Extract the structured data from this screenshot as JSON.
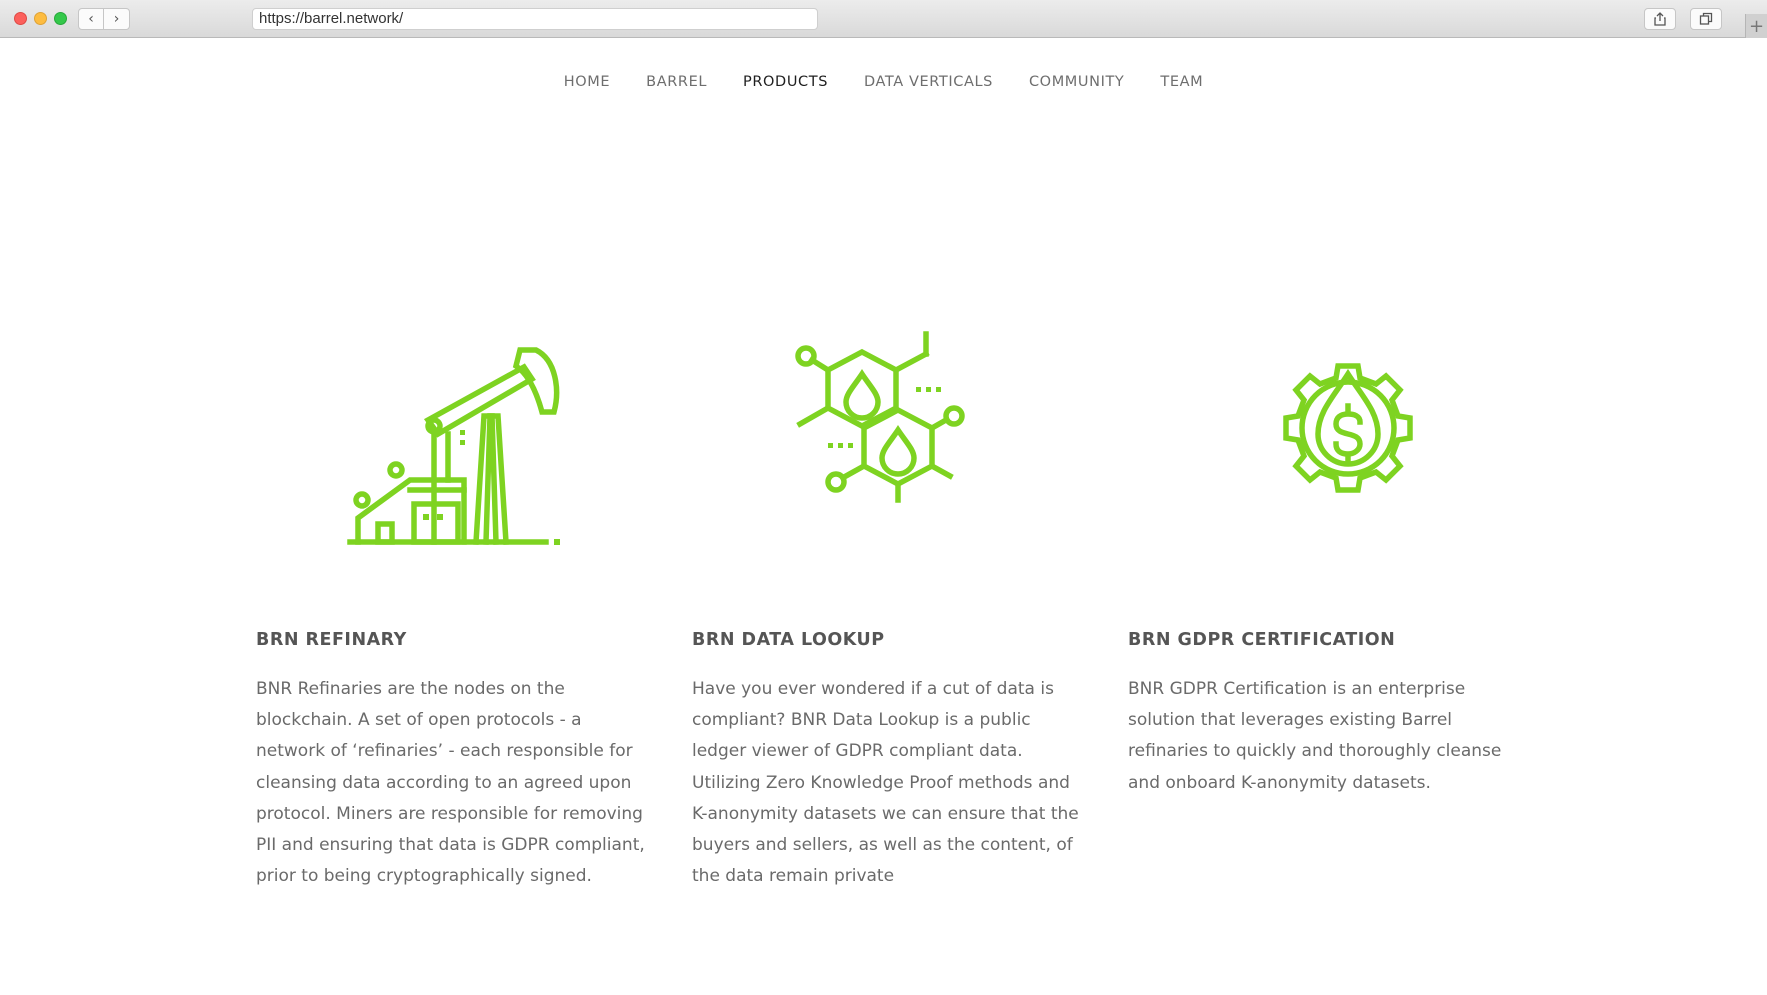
{
  "browser": {
    "url": "https://barrel.network/",
    "back_glyph": "‹",
    "forward_glyph": "›",
    "new_tab_glyph": "+"
  },
  "nav": {
    "items": [
      {
        "label": "HOME"
      },
      {
        "label": "BARREL"
      },
      {
        "label": "PRODUCTS",
        "active": true
      },
      {
        "label": "DATA VERTICALS"
      },
      {
        "label": "COMMUNITY"
      },
      {
        "label": "TEAM"
      }
    ]
  },
  "colors": {
    "accent": "#7ed321",
    "heading": "#555555",
    "body_text": "#6a6a6a",
    "nav_text": "#6e6e6e",
    "nav_active": "#1f1f1f"
  },
  "products": [
    {
      "icon": "oil-pump-refinery-icon",
      "title": "BRN REFINARY",
      "description": "BNR Refinaries are the nodes on the blockchain.  A set of open protocols - a network of ‘refinaries’ - each responsible for cleansing data according to an agreed upon protocol. Miners are responsible for removing PII and ensuring that data is GDPR compliant, prior to being cryptographically signed."
    },
    {
      "icon": "hexagon-droplets-network-icon",
      "title": "BRN DATA LOOKUP",
      "description": "Have you ever wondered if a cut of data is compliant? BNR Data Lookup is a public ledger viewer of GDPR compliant data. Utilizing Zero Knowledge Proof methods and K-anonymity datasets we can ensure that the buyers and sellers, as well as the content, of the data remain private"
    },
    {
      "icon": "gear-dollar-droplet-icon",
      "title": "BRN GDPR CERTIFICATION",
      "description": "BNR GDPR Certification is an enterprise solution that leverages existing Barrel refinaries to quickly and thoroughly cleanse and onboard K-anonymity datasets."
    }
  ]
}
